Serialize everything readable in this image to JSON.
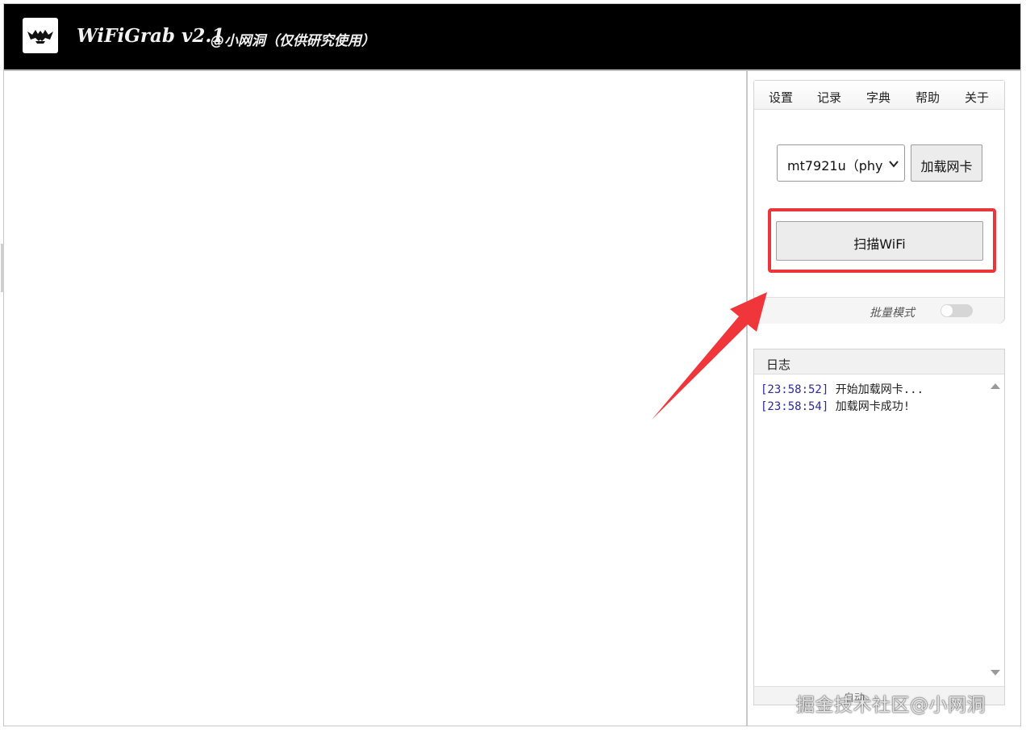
{
  "app": {
    "title": "WiFiGrab v2.1",
    "subtitle": "@小网洞（仅供研究使用）",
    "logo_icon": "bat-logo-icon"
  },
  "menu": {
    "items": [
      "设置",
      "记录",
      "字典",
      "帮助",
      "关于"
    ]
  },
  "controls": {
    "adapter_selected": "mt7921u（phy",
    "load_button": "加载网卡",
    "scan_button": "扫描WiFi",
    "batch_mode_label": "批量模式",
    "batch_mode_on": false,
    "highlight_color": "#e8363b"
  },
  "log": {
    "title": "日志",
    "entries": [
      {
        "time": "[23:58:52]",
        "message": "开始加载网卡..."
      },
      {
        "time": "[23:58:54]",
        "message": "加载网卡成功!"
      }
    ],
    "footer_text": "自动"
  },
  "watermark": "掘金技术社区@小网洞",
  "annotation": {
    "arrow_color": "#f0363a"
  }
}
